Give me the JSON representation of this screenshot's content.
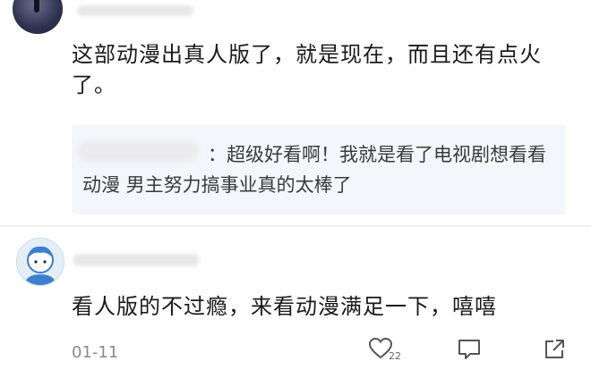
{
  "comment": {
    "text": "这部动漫出真人版了，就是现在，而且还有点火了。"
  },
  "reply": {
    "separator": "：",
    "text": "超级好看啊！我就是看了电视剧想看看动漫 男主努力搞事业真的太棒了"
  },
  "reply2": {
    "text": "看人版的不过瘾，来看动漫满足一下，嘻嘻",
    "date": "01-11",
    "like_count": "22"
  },
  "icons": [
    "avatar",
    "heart-icon",
    "comment-icon",
    "share-icon"
  ],
  "colors": {
    "reply_bg": "#f5f6fb",
    "meta_text": "#8a8a8a"
  }
}
